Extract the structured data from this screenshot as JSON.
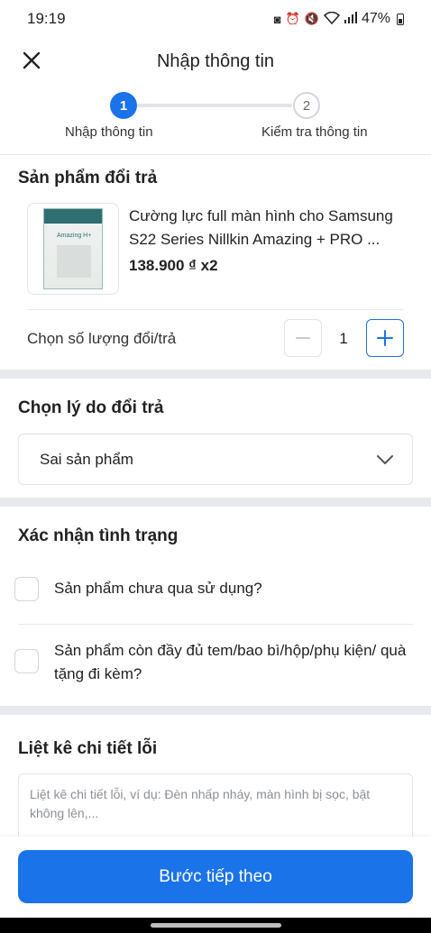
{
  "status_bar": {
    "time": "19:19",
    "battery": "47%",
    "icons": [
      "sim-icon",
      "alarm-icon",
      "mute-icon",
      "wifi-icon",
      "signal-icon",
      "battery-icon"
    ]
  },
  "header": {
    "title": "Nhập thông tin",
    "close_icon": "close-icon"
  },
  "stepper": {
    "steps": [
      {
        "number": "1",
        "label": "Nhập thông tin",
        "active": true
      },
      {
        "number": "2",
        "label": "Kiểm tra thông tin",
        "active": false
      }
    ]
  },
  "product_section": {
    "title": "Sản phẩm đổi trả",
    "product": {
      "thumb_text": "Amazing H+",
      "name": "Cường lực full màn hình cho Samsung S22 Series Nillkin Amazing + PRO ...",
      "price": "138.900 ₫ x2"
    },
    "quantity": {
      "label": "Chọn số lượng đổi/trả",
      "value": "1"
    }
  },
  "reason_section": {
    "title": "Chọn lý do đổi trả",
    "selected": "Sai sản phẩm"
  },
  "condition_section": {
    "title": "Xác nhận tình trạng",
    "items": [
      {
        "label": "Sản phẩm chưa qua sử dụng?",
        "checked": false
      },
      {
        "label": "Sản phẩm còn đầy đủ tem/bao bì/hộp/phụ kiện/ quà tặng đi kèm?",
        "checked": false
      }
    ]
  },
  "details_section": {
    "title": "Liệt kê chi tiết lỗi",
    "placeholder": "Liệt kê chi tiết lỗi, ví dụ: Đèn nhấp nháy, màn hình bị sọc, bật không lên,..."
  },
  "footer": {
    "next_label": "Bước tiếp theo"
  },
  "colors": {
    "accent": "#1a73e8",
    "divider": "#e8e9ec",
    "border": "#e1e3e8"
  }
}
